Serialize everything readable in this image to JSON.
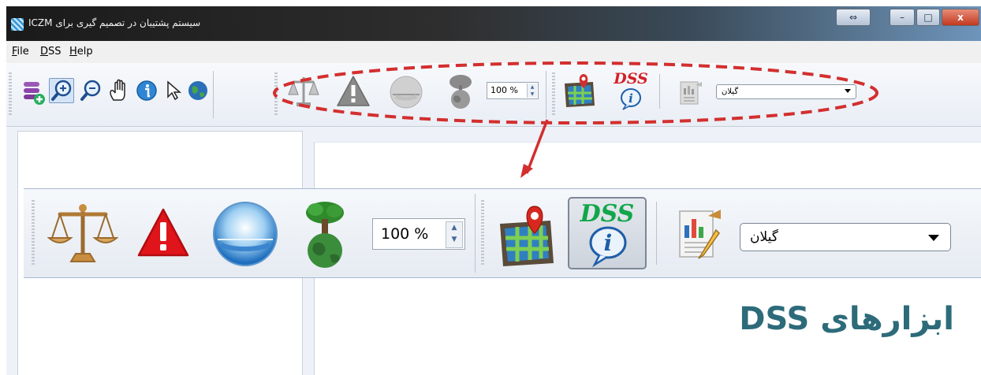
{
  "window": {
    "title": "سیستم پشتیبان در تصمیم گیری برای ICZM",
    "controls": {
      "resize": "⇔",
      "minimize": "–",
      "maximize": "□",
      "close": "x"
    }
  },
  "menu": [
    {
      "label": "File",
      "accel": "F"
    },
    {
      "label": "DSS",
      "accel": "D"
    },
    {
      "label": "Help",
      "accel": "H"
    }
  ],
  "toolbar_small": {
    "tools": [
      "add-layer-icon",
      "zoom-in-icon",
      "zoom-out-icon",
      "pan-hand-icon",
      "info-icon",
      "pointer-icon",
      "globe-icon"
    ],
    "dss_tools": [
      "scales-icon",
      "warning-icon",
      "weather-icon",
      "tree-globe-icon"
    ],
    "zoom_value": "100 %",
    "map_tools": [
      "map-grid-pin-icon",
      "dss-info-icon",
      "report-icon"
    ],
    "province_selected": "گیلان"
  },
  "toolbar_big": {
    "tools": [
      "scales-icon",
      "warning-icon",
      "weather-icon",
      "tree-globe-icon"
    ],
    "zoom_value": "100 %",
    "map_tools": [
      "map-grid-pin-icon",
      "dss-info-icon",
      "report-icon"
    ],
    "dss_label": "DSS",
    "province_selected": "گیلان"
  },
  "caption": "ابزارهای DSS",
  "colors": {
    "annotation": "#d32f2f",
    "caption": "#2d6b7a",
    "dss_red": "#d32027"
  }
}
